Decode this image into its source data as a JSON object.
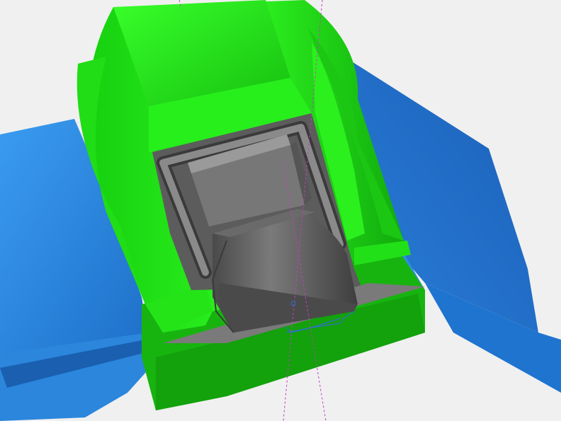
{
  "viewport": {
    "label": "3D CAD viewport",
    "colors": {
      "background": "#f0f0f0",
      "green_light": "#22f01a",
      "green_mid": "#19c812",
      "green_dark": "#0e8f0c",
      "green_base": "#18b010",
      "blue_light": "#2f8ee6",
      "blue_mid": "#1e6fc8",
      "blue_dark": "#1656a8",
      "grey_light": "#8a8a8a",
      "grey_mid": "#6e6e6e",
      "grey_dark": "#4e4e4e",
      "axis_magenta": "#c040c0",
      "sketch_blue": "#3070d0"
    }
  }
}
